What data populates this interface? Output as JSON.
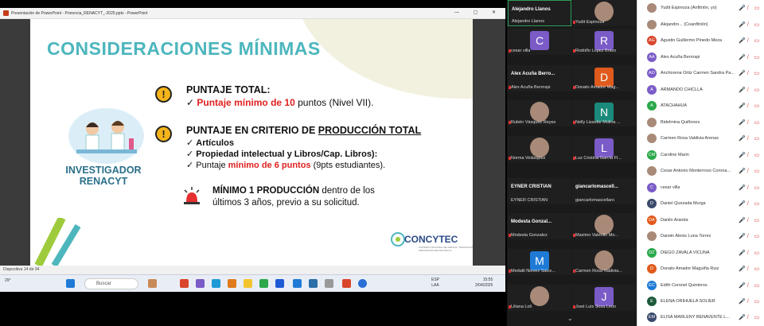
{
  "window": {
    "title": "Presentación de PowerPoint  -  Ponencia_RENACYT_-2025.pptx - PowerPoint"
  },
  "slide": {
    "title": "CONSIDERACIONES MÍNIMAS",
    "s1_head": "PUNTAJE TOTAL:",
    "s1_red": "Puntaje mínimo de 10",
    "s1_rest": " puntos (Nivel VII).",
    "s2_head_a": "PUNTAJE EN CRITERIO DE ",
    "s2_head_u": "PRODUCCIÓN TOTAL",
    "s2_b1": "Artículos",
    "s2_b2": "Propiedad intelectual y Libros/Cap. Libros):",
    "s2_b3_a": "Puntaje ",
    "s2_b3_red": "mínimo de 6 puntos",
    "s2_b3_c": " (9pts estudiantes).",
    "s3_bold": "MÍNIMO 1 PRODUCCIÓN",
    "s3_rest": " dentro de los",
    "s3_line2": "últimos 3 años, previo a su solicitud.",
    "investigador": "INVESTIGADOR",
    "renacyt": "RENACYT",
    "logo": "CONCYTEC",
    "logo_sub": "CONSEJO NACIONAL DE CIENCIA, TECNOLOGÍA E INNOVACIÓN TECNOLÓGICA"
  },
  "statusbar": {
    "slide": "Diapositiva 14 de 34"
  },
  "taskbar": {
    "temp": "29°",
    "search": "Buscar",
    "lang": "ESP",
    "lang2": "LAA",
    "time": "15:55",
    "date": "2/04/2025"
  },
  "tiles": [
    {
      "name": "Alejandro Llanos",
      "big": "Alejandro Llanos"
    },
    {
      "name": "Yudit Espinoza"
    },
    {
      "name": "cesar villa",
      "letter": "C",
      "color": "#7a5bc7"
    },
    {
      "name": "Rodolfo Lopez Bravo",
      "letter": "R",
      "color": "#7a5bc7"
    },
    {
      "name": "Alex Acuña Berrospi",
      "big": "Alex Acuña Berro..."
    },
    {
      "name": "Donato Amador Mag...",
      "letter": "D",
      "color": "#e05a1c"
    },
    {
      "name": "Rubén Vásquez Reyes"
    },
    {
      "name": "Nelly Lissette Molina ...",
      "letter": "N",
      "color": "#1b8a7a"
    },
    {
      "name": "Norma Velásquez"
    },
    {
      "name": "Luz Cristina García Fl...",
      "letter": "L",
      "color": "#7a5bc7"
    },
    {
      "name": "EYNER CRISTIAN",
      "big": "EYNER CRISTIAN"
    },
    {
      "name": "giancarlomascellaro",
      "big": "giancarlomascell..."
    },
    {
      "name": "Modesta Gonzalez",
      "big": "Modesta Gonzal..."
    },
    {
      "name": "Maximo Valentin Mo..."
    },
    {
      "name": "Medalit Nieves Salce...",
      "letter": "M",
      "color": "#1f7ad6"
    },
    {
      "name": "Carmen Rosa Valdivia..."
    },
    {
      "name": "Liliana Loli"
    },
    {
      "name": "José Luis Sosa León",
      "letter": "J",
      "color": "#7a5bc7"
    }
  ],
  "participants": [
    {
      "name": "Yudit Espinoza (Anfitrión, yo)"
    },
    {
      "name": "Alejandro... (Coanfitrión)"
    },
    {
      "name": "Agustin Guillermo Pinedo Meza",
      "init": "AG",
      "color": "#d9452b"
    },
    {
      "name": "Alex Acuña Berrospi",
      "init": "AA",
      "color": "#7a5bc7"
    },
    {
      "name": "Anchorena Ortiz Carmen Sandra Pa...",
      "init": "AO",
      "color": "#7a5bc7"
    },
    {
      "name": "ARMANDO CHICLLA",
      "init": "A",
      "color": "#7a5bc7"
    },
    {
      "name": "ATACHAHUA",
      "init": "A",
      "color": "#2aa84a"
    },
    {
      "name": "Bidelmina Quiñones"
    },
    {
      "name": "Carmen Rosa Valdivia Arenas"
    },
    {
      "name": "Caroline Marin",
      "init": "CM",
      "color": "#2aa84a"
    },
    {
      "name": "Cesar Antonio Monterroso Corona..."
    },
    {
      "name": "cesar villa",
      "init": "C",
      "color": "#7a5bc7"
    },
    {
      "name": "Daniel Quezada Murga",
      "init": "D",
      "color": "#3a4a6b"
    },
    {
      "name": "Danilo Aranda",
      "init": "DA",
      "color": "#e05a1c"
    },
    {
      "name": "Darwin Alexis Luna Torres"
    },
    {
      "name": "DIEGO ZAVALA VICUÑA",
      "init": "DZ",
      "color": "#2aa84a"
    },
    {
      "name": "Donato Amador Maguiña Ruiz",
      "init": "D",
      "color": "#e05a1c"
    },
    {
      "name": "Edith Coronel Quinteros",
      "init": "EC",
      "color": "#1f7ad6"
    },
    {
      "name": "ELENA ORIHUELA SOLIER",
      "init": "E",
      "color": "#1b5a3a"
    },
    {
      "name": "ELISA MARLENY BENAVENTE L...",
      "init": "EM",
      "color": "#3a4a6b"
    }
  ]
}
